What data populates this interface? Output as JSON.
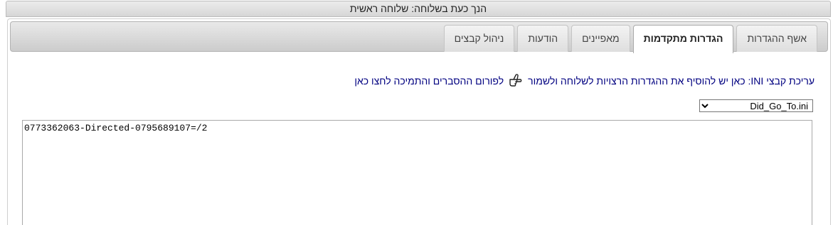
{
  "header": {
    "title": "הנך כעת בשלוחה: שלוחה ראשית"
  },
  "tabs": [
    {
      "label": "ניהול קבצים",
      "active": false
    },
    {
      "label": "הודעות",
      "active": false
    },
    {
      "label": "מאפיינים",
      "active": false
    },
    {
      "label": "הגדרות מתקדמות",
      "active": true
    },
    {
      "label": "אשף ההגדרות",
      "active": false
    }
  ],
  "info": {
    "text": "עריכת קבצי INI: כאן יש להוסיף את ההגדרות הרצויות לשלוחה ולשמור",
    "icon": "pointing-hand-icon",
    "link": "לפורום ההסברים והתמיכה לחצו כאן"
  },
  "file_select": {
    "selected": "Did_Go_To.ini"
  },
  "editor": {
    "content": "0773362063-Directed-0795689107=/2"
  },
  "colors": {
    "link": "#000080",
    "tab_bar": "#d6d6d6"
  }
}
